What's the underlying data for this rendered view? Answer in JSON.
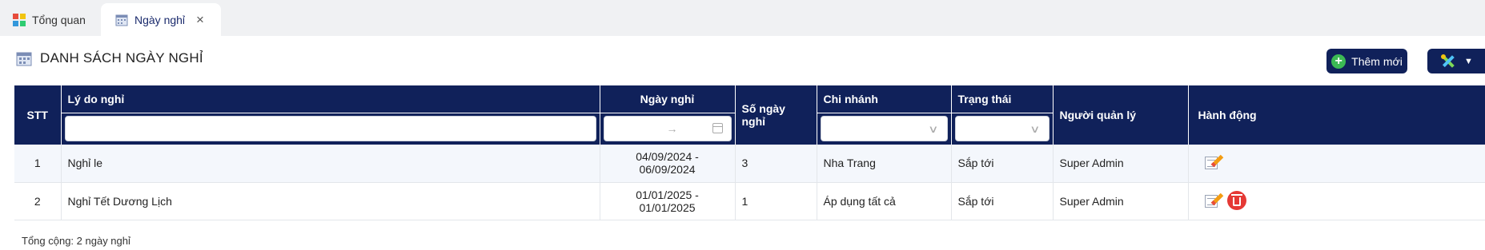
{
  "tabs": [
    {
      "label": "Tổng quan",
      "icon": "dashboard-icon"
    },
    {
      "label": "Ngày nghỉ",
      "icon": "calendar-icon",
      "active": true
    }
  ],
  "page": {
    "title": "DANH SÁCH NGÀY NGHỈ",
    "add_button": "Thêm mới"
  },
  "table": {
    "columns": {
      "stt": "STT",
      "reason": "Lý do nghỉ",
      "dates": "Ngày nghỉ",
      "days": "Số ngày nghỉ",
      "branch": "Chi nhánh",
      "status": "Trạng thái",
      "manager": "Người quản lý",
      "actions": "Hành động"
    },
    "filters": {
      "reason": "",
      "date_arrow": "→",
      "branch": "",
      "status": ""
    },
    "rows": [
      {
        "stt": "1",
        "reason": "Nghỉ le",
        "dates": "04/09/2024 - 06/09/2024",
        "days": "3",
        "branch": "Nha Trang",
        "status": "Sắp tới",
        "manager": "Super Admin",
        "can_delete": false
      },
      {
        "stt": "2",
        "reason": "Nghỉ Tết Dương Lịch",
        "dates": "01/01/2025 - 01/01/2025",
        "days": "1",
        "branch": "Áp dụng tất cả",
        "status": "Sắp tới",
        "manager": "Super Admin",
        "can_delete": true
      }
    ]
  },
  "footer": {
    "total": "Tổng cộng: 2 ngày nghỉ"
  },
  "colors": {
    "header_bg": "#10215a",
    "add_icon": "#3cba54",
    "delete": "#e53935"
  }
}
